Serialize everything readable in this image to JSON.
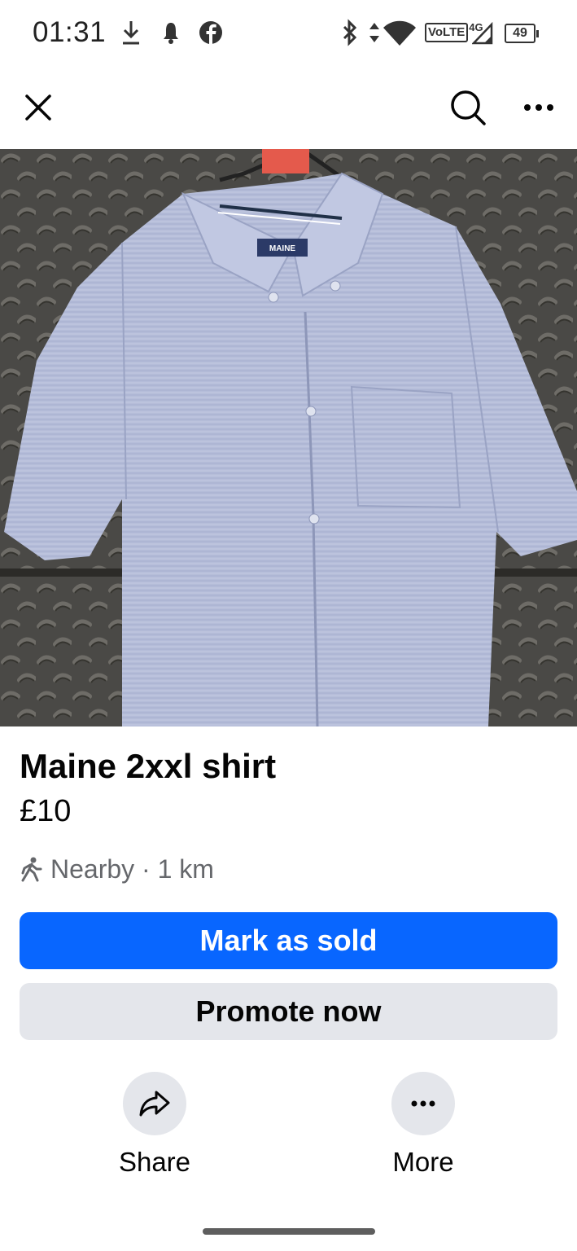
{
  "status_bar": {
    "time": "01:31",
    "network": "VoLTE",
    "network_gen": "4G",
    "battery": "49",
    "icons": [
      "download-icon",
      "notification-bell-icon",
      "facebook-icon",
      "bluetooth-icon",
      "data-arrows-icon",
      "wifi-icon",
      "cell-signal-icon",
      "battery-icon"
    ]
  },
  "top_bar": {
    "icons": [
      "close-icon",
      "search-icon",
      "more-icon"
    ]
  },
  "listing": {
    "photo_icon": "shirt-photo",
    "brand_tag": "MAINE",
    "title": "Maine 2xxl shirt",
    "price": "£10",
    "location_icon": "walking-person-icon",
    "location": "Nearby · 1 km"
  },
  "buttons": {
    "mark_sold": "Mark as sold",
    "promote": "Promote now"
  },
  "actions": {
    "share": {
      "label": "Share",
      "icon": "share-arrow-icon"
    },
    "more": {
      "label": "More",
      "icon": "more-icon"
    }
  },
  "colors": {
    "primary": "#0866ff",
    "secondary_bg": "#e4e6eb",
    "muted_text": "#65676b",
    "text": "#050505"
  }
}
